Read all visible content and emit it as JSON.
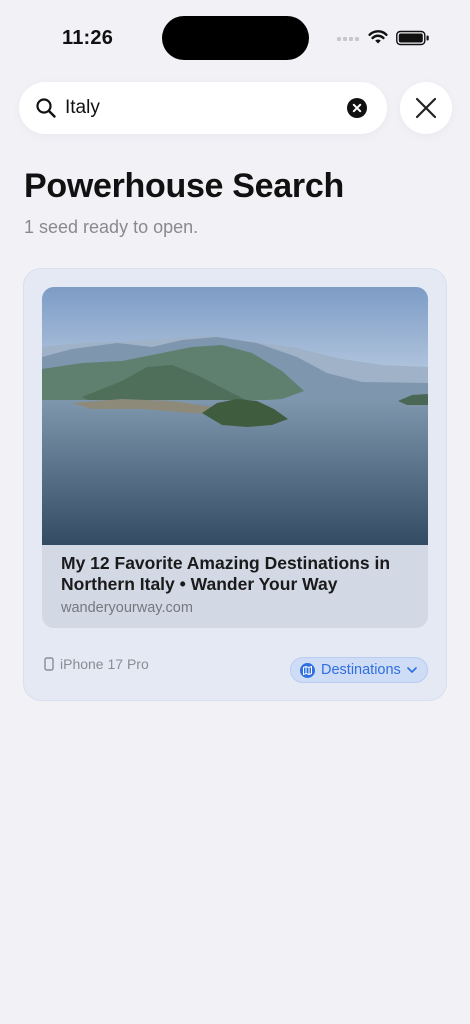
{
  "status_bar": {
    "time": "11:26"
  },
  "search": {
    "value": "Italy"
  },
  "page": {
    "title": "Powerhouse Search",
    "subtitle": "1 seed ready to open."
  },
  "result": {
    "title": "My 12 Favorite Amazing Destinations in Northern Italy • Wander Your Way",
    "domain": "wanderyourway.com",
    "device": "iPhone 17 Pro",
    "category": "Destinations"
  }
}
